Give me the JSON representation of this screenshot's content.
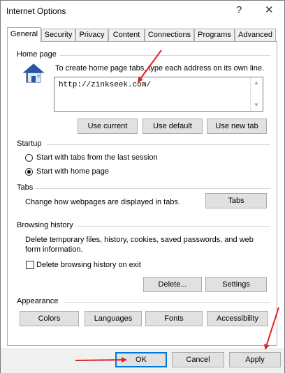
{
  "window": {
    "title": "Internet Options",
    "help_glyph": "?",
    "close_glyph": "✕"
  },
  "tabs": [
    {
      "label": "General",
      "active": true
    },
    {
      "label": "Security"
    },
    {
      "label": "Privacy"
    },
    {
      "label": "Content"
    },
    {
      "label": "Connections"
    },
    {
      "label": "Programs"
    },
    {
      "label": "Advanced"
    }
  ],
  "home_page": {
    "title": "Home page",
    "description": "To create home page tabs, type each address on its own line.",
    "value": "http://zinkseek.com/",
    "use_current": "Use current",
    "use_default": "Use default",
    "use_new_tab": "Use new tab"
  },
  "startup": {
    "title": "Startup",
    "option_last_session": "Start with tabs from the last session",
    "option_home_page": "Start with home page",
    "selected": "home_page"
  },
  "tabs_section": {
    "title": "Tabs",
    "description": "Change how webpages are displayed in tabs.",
    "button": "Tabs"
  },
  "browsing_history": {
    "title": "Browsing history",
    "description": "Delete temporary files, history, cookies, saved passwords, and web form information.",
    "delete_on_exit": "Delete browsing history on exit",
    "delete_on_exit_checked": false,
    "delete_button": "Delete...",
    "settings_button": "Settings"
  },
  "appearance": {
    "title": "Appearance",
    "colors": "Colors",
    "languages": "Languages",
    "fonts": "Fonts",
    "accessibility": "Accessibility"
  },
  "footer": {
    "ok": "OK",
    "cancel": "Cancel",
    "apply": "Apply"
  },
  "annotation_color": "#e02020",
  "accent_color": "#0078d7"
}
